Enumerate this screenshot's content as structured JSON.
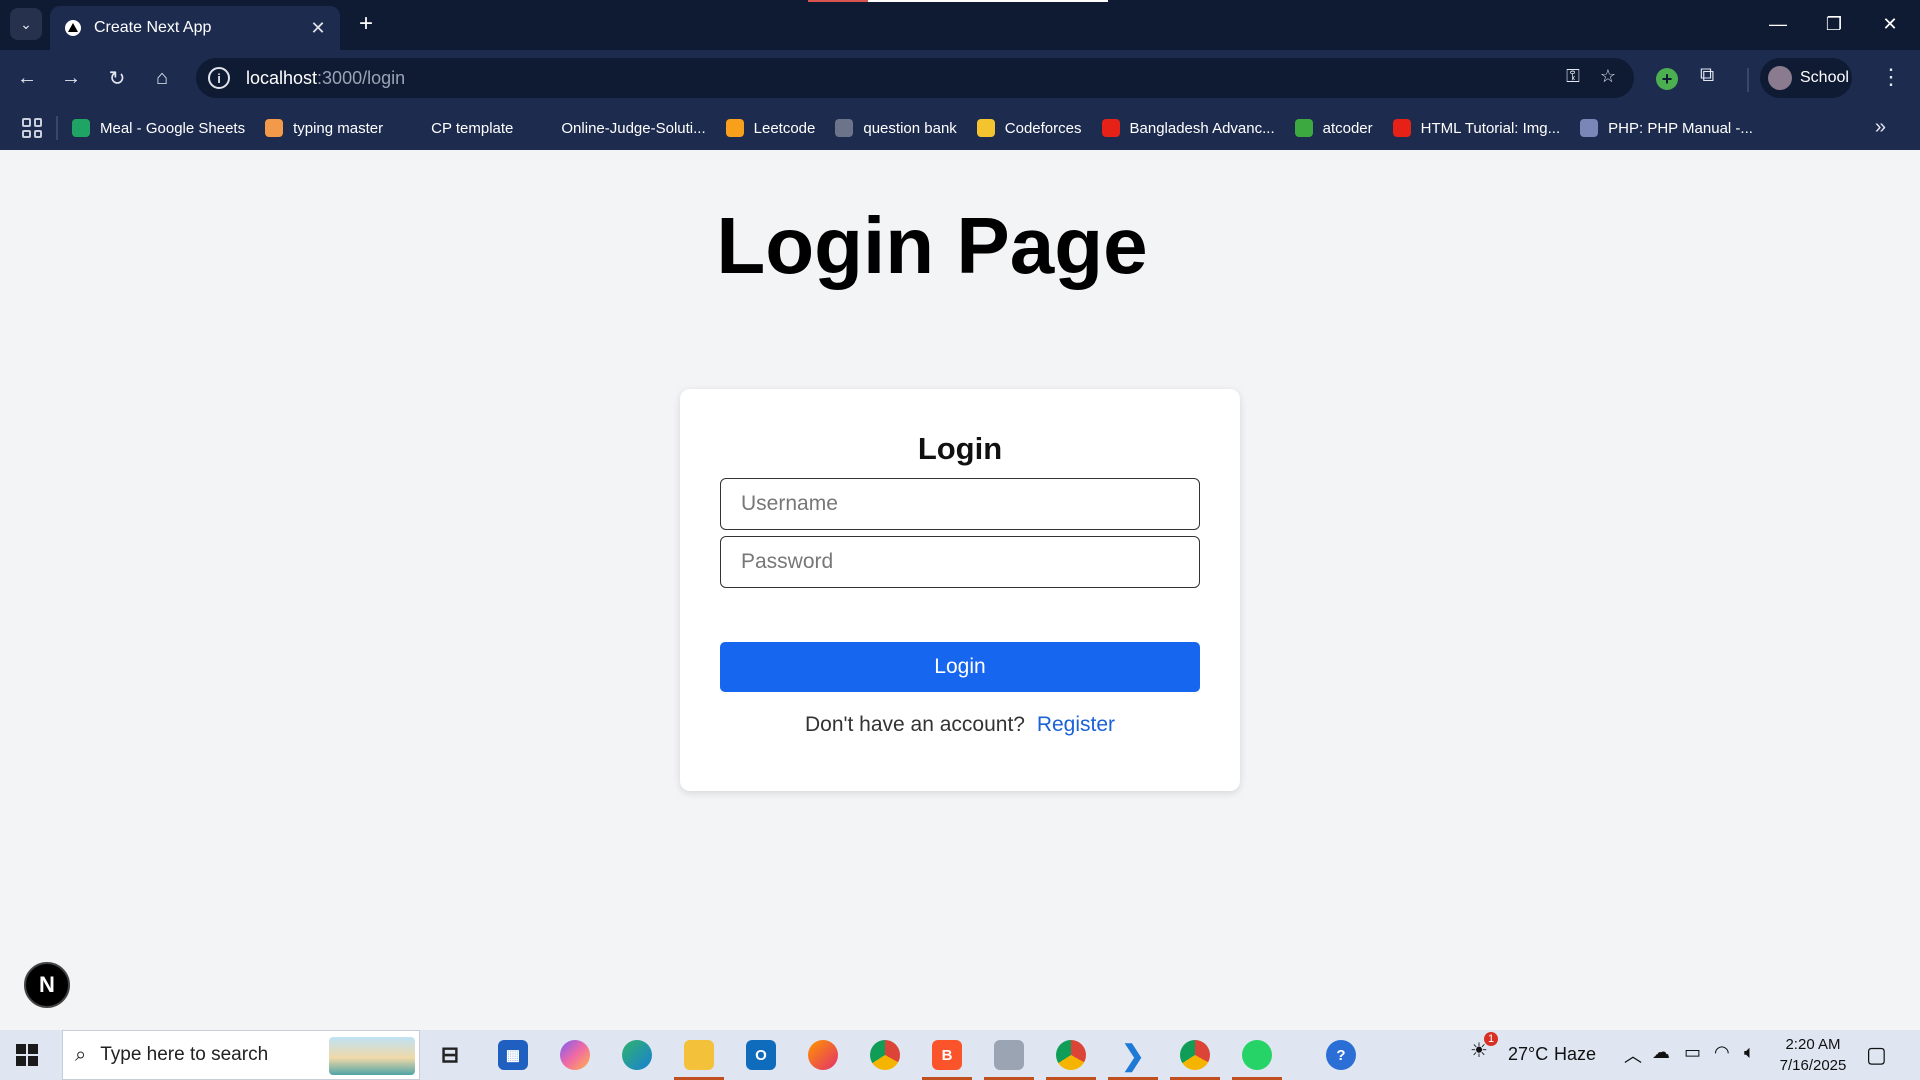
{
  "browser": {
    "tab_title": "Create Next App",
    "url_host": "localhost",
    "url_path": ":3000/login",
    "profile_label": "School",
    "bookmarks": [
      {
        "label": "Meal - Google Sheets",
        "icon": "google-sheets-icon",
        "color": "#1fa463"
      },
      {
        "label": "typing master",
        "icon": "typing-master-icon",
        "color": "#f2994a"
      },
      {
        "label": "CP template",
        "icon": "github-icon",
        "color": "#1d2b4f"
      },
      {
        "label": "Online-Judge-Soluti...",
        "icon": "github-icon",
        "color": "#1d2b4f"
      },
      {
        "label": "Leetcode",
        "icon": "leetcode-icon",
        "color": "#f89f1b"
      },
      {
        "label": "question bank",
        "icon": "globe-icon",
        "color": "#6b7488"
      },
      {
        "label": "Codeforces",
        "icon": "codeforces-icon",
        "color": "#f4c430"
      },
      {
        "label": "Bangladesh Advanc...",
        "icon": "youtube-icon",
        "color": "#e62117"
      },
      {
        "label": "atcoder",
        "icon": "atcoder-icon",
        "color": "#3ca840"
      },
      {
        "label": "HTML Tutorial: Img...",
        "icon": "youtube-icon",
        "color": "#e62117"
      },
      {
        "label": "PHP: PHP Manual -...",
        "icon": "php-icon",
        "color": "#7a86b8"
      }
    ]
  },
  "page": {
    "heading": "Login Page",
    "form": {
      "title": "Login",
      "username_placeholder": "Username",
      "password_placeholder": "Password",
      "submit_label": "Login",
      "register_prompt": "Don't have an account?",
      "register_link": "Register"
    },
    "next_badge": "N"
  },
  "taskbar": {
    "search_placeholder": "Type here to search",
    "weather_temp": "27°C",
    "weather_desc": "Haze",
    "weather_alert": "1",
    "time": "2:20 AM",
    "date": "7/16/2025"
  },
  "colors": {
    "accent": "#1666f0",
    "link": "#1a62d8",
    "chrome_dark": "#0f1a33",
    "chrome_mid": "#1d2b4f"
  }
}
